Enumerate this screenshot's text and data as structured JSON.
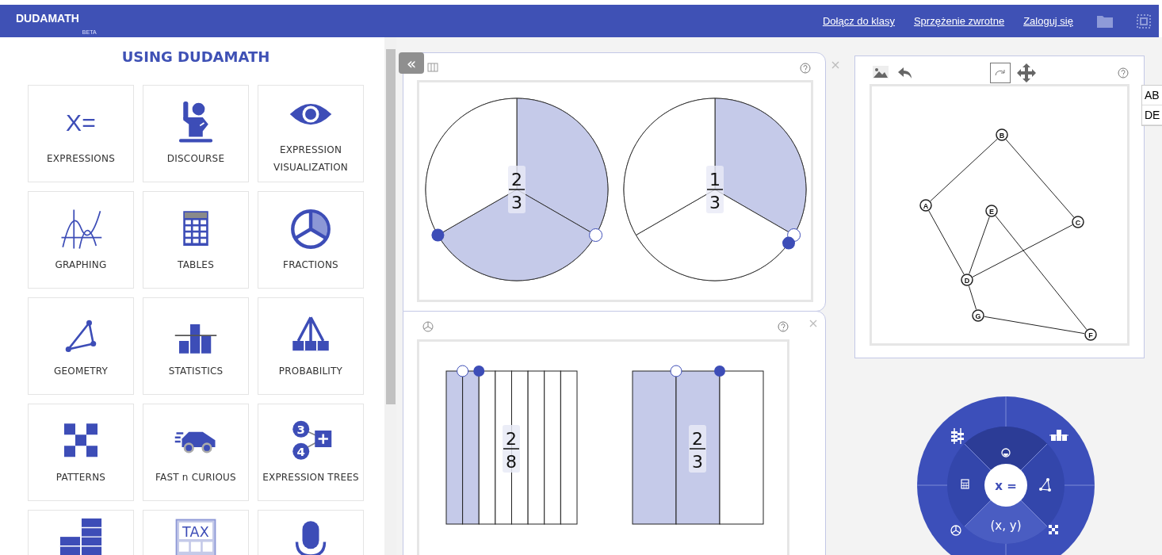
{
  "header": {
    "logo": "DUDAMATH",
    "badge": "BETA",
    "links": [
      "Dołącz do klasy",
      "Sprzężenie zwrotne",
      "Zaloguj się"
    ]
  },
  "sidebar": {
    "title": "USING DUDAMATH",
    "tiles": [
      {
        "kind": "glyph",
        "glyphs": [
          "X="
        ],
        "label": "EXPRESSIONS"
      },
      {
        "kind": "discourse",
        "label": "DISCOURSE"
      },
      {
        "kind": "eye",
        "label": "EXPRESSION VISUALIZATION"
      },
      {
        "kind": "graph",
        "label": "GRAPHING"
      },
      {
        "kind": "table",
        "label": "TABLES"
      },
      {
        "kind": "pie",
        "label": "FRACTIONS"
      },
      {
        "kind": "geometry",
        "label": "GEOMETRY"
      },
      {
        "kind": "statistics",
        "label": "STATISTICS"
      },
      {
        "kind": "probability",
        "label": "PROBABILITY"
      },
      {
        "kind": "patterns",
        "label": "PATTERNS"
      },
      {
        "kind": "car",
        "label": "FAST n CURIOUS"
      },
      {
        "kind": "tree",
        "glyphs": [
          "3",
          "4"
        ],
        "label": "EXPRESSION TREES"
      },
      {
        "kind": "bars"
      },
      {
        "kind": "tax",
        "glyphs": [
          "TAX"
        ]
      },
      {
        "kind": "mic"
      }
    ]
  },
  "collapse_button": "«",
  "pie_panel": {
    "fractions": [
      {
        "numerator": "2",
        "denominator": "3",
        "parts": [
          {
            "shaded": true
          },
          {
            "shaded": true
          },
          {
            "shaded": false
          }
        ]
      },
      {
        "numerator": "1",
        "denominator": "3",
        "parts": [
          {
            "shaded": true
          },
          {
            "shaded": false
          },
          {
            "shaded": false
          }
        ]
      }
    ]
  },
  "bar_panel": {
    "fractions": [
      {
        "numerator": "2",
        "denominator": "8",
        "parts": [
          {
            "shaded": true
          },
          {
            "shaded": true
          },
          {
            "shaded": false
          },
          {
            "shaded": false
          },
          {
            "shaded": false
          },
          {
            "shaded": false
          },
          {
            "shaded": false
          },
          {
            "shaded": false
          }
        ]
      },
      {
        "numerator": "2",
        "denominator": "3",
        "parts": [
          {
            "shaded": true
          },
          {
            "shaded": true
          },
          {
            "shaded": false
          }
        ]
      }
    ]
  },
  "graph_panel": {
    "nodes": [
      "A",
      "B",
      "C",
      "D",
      "E",
      "F",
      "G"
    ]
  },
  "side_table": {
    "cells": [
      "AB",
      "DE"
    ]
  },
  "radial_menu": {
    "center": "x =",
    "bottom": "(x, y)"
  }
}
